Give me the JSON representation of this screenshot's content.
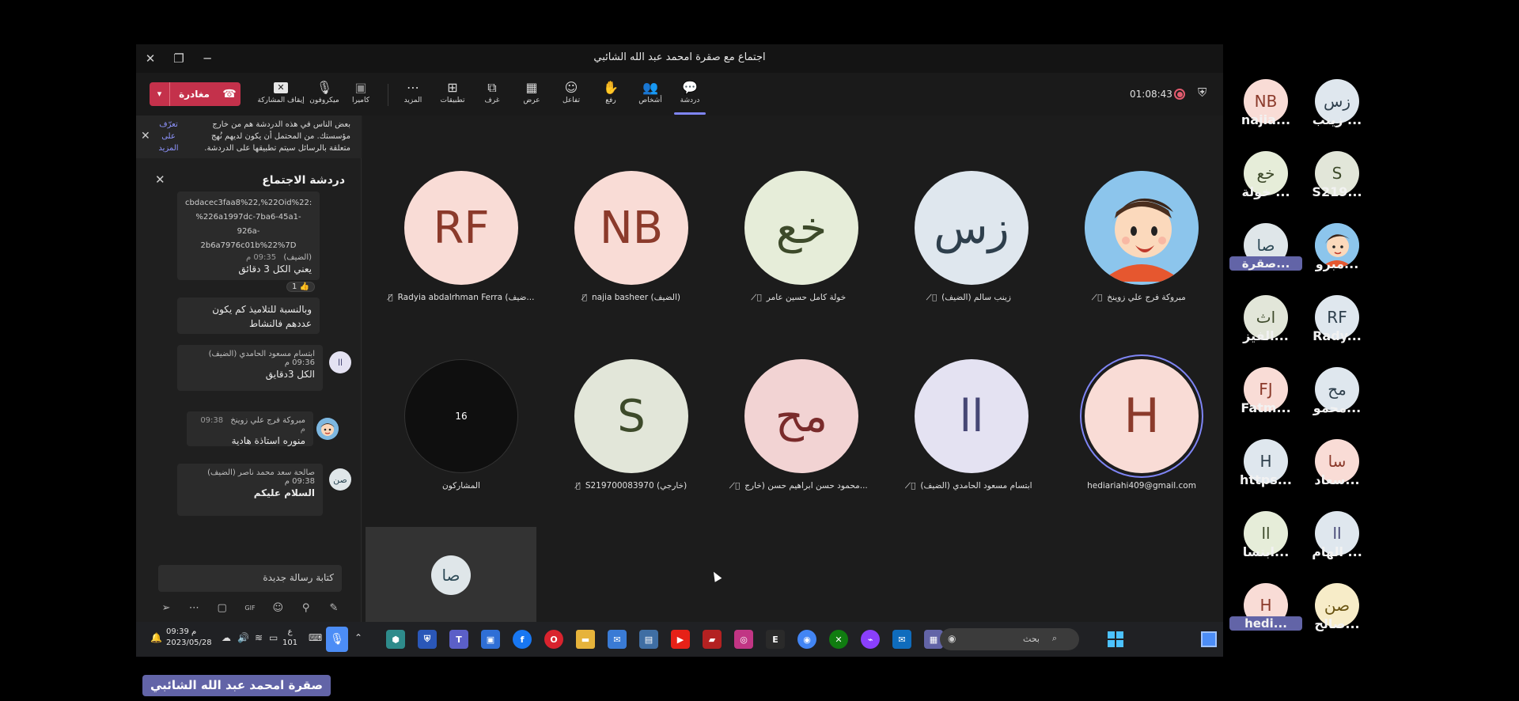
{
  "window": {
    "title": "اجتماع مع صقرة امحمد عبد الله الشائبي"
  },
  "toolbar": {
    "leave_label": "مغادرة",
    "timer": "01:08:43",
    "items": [
      {
        "label": "كاميرا",
        "icon": "camera-off-icon"
      },
      {
        "label": "ميكروفون",
        "icon": "microphone-icon"
      },
      {
        "label": "إيقاف المشاركة",
        "icon": "stop-share-icon"
      },
      {
        "label": "المزيد",
        "icon": "more-icon"
      },
      {
        "label": "تطبيقات",
        "icon": "apps-icon"
      },
      {
        "label": "غرف",
        "icon": "rooms-icon"
      },
      {
        "label": "عرض",
        "icon": "view-icon"
      },
      {
        "label": "تفاعل",
        "icon": "react-icon"
      },
      {
        "label": "رفع",
        "icon": "raise-hand-icon"
      },
      {
        "label": "أشخاص",
        "icon": "people-icon"
      },
      {
        "label": "دردشة",
        "icon": "chat-icon"
      }
    ]
  },
  "chat": {
    "notice_text": "بعض الناس في هذه الدردشة هم من خارج مؤسستك. من المحتمل أن يكون لديهم نُهج متعلقة بالرسائل سيتم تطبيقها على الدردشة.",
    "notice_link": "تعرّف على المزيد",
    "title": "دردشة الاجتماع",
    "compose_placeholder": "كتابة رسالة جديدة",
    "messages": [
      {
        "link_lines": [
          "cbdacec3faa8%22,%22Oid%22:",
          "%226a1997dc-7ba6-45a1-926a-",
          "2b6a7976c01b%22%7D"
        ],
        "meta": "(الضيف)",
        "time": "09:35 م",
        "body": "يعني الكل 3 دقائق",
        "reaction": "1 👍"
      },
      {
        "body": "وبالنسبة للتلاميذ كم يكون عددهم فالنشاط"
      },
      {
        "avatar": "اا",
        "meta": "ابتسام مسعود الحامدي (الضيف)",
        "time": "09:36 م",
        "body": "الكل 3دقايق"
      },
      {
        "meta": "مبروكة فرج علي زوينخ",
        "time": "09:38 م",
        "body": "منوره استاذة هادية"
      },
      {
        "avatar": "صن",
        "meta": "صالحة سعد محمد ناصر (الضيف)",
        "time": "09:38 م",
        "body": "السلام عليكم"
      }
    ]
  },
  "grid": {
    "tiles": [
      {
        "initials": "RF",
        "name": "Radyia abdalrhman Ferra (ضيف...",
        "bg": "#f9dcd6",
        "fg": "#8b3a2b",
        "muted": true
      },
      {
        "initials": "NB",
        "name": "najia basheer (الضيف)",
        "bg": "#f9dcd6",
        "fg": "#8b3a2b",
        "muted": true
      },
      {
        "initials": "خع",
        "name": "خولة كامل حسين عامر",
        "bg": "#e6edd9",
        "fg": "#3d4a2a",
        "muted": true
      },
      {
        "initials": "زس",
        "name": "زينب سالم (الضيف)",
        "bg": "#dfe7ee",
        "fg": "#2e3f4c",
        "muted": true
      },
      {
        "initials": "",
        "name": "مبروكة فرج علي زوينخ",
        "bg": "#6fb0e0",
        "fg": "#ffffff",
        "muted": true
      },
      {
        "initials": "16",
        "name": "المشاركون",
        "bg": "#0f0f0f",
        "fg": "#ffffff",
        "muted": false
      },
      {
        "initials": "S",
        "name": "S219700083970 (خارجي)",
        "bg": "#e2e6d9",
        "fg": "#3d4a2a",
        "muted": true
      },
      {
        "initials": "مح",
        "name": "محمود حسن ابراهيم حسن (خارج...",
        "bg": "#f2d3d3",
        "fg": "#7a2b2b",
        "muted": true
      },
      {
        "initials": "اا",
        "name": "ابتسام مسعود الحامدي (الضيف)",
        "bg": "#e4e2f2",
        "fg": "#464775",
        "muted": true
      },
      {
        "initials": "H",
        "name": "hediariahi409@gmail.com",
        "bg": "#f9dcd6",
        "fg": "#8b3a2b",
        "muted": false
      }
    ],
    "self_initials": "صا"
  },
  "taskbar": {
    "time": "09:39 م",
    "date": "2023/05/28",
    "lang": "ع",
    "lang_sub": "101",
    "search_placeholder": "بحث",
    "apps": [
      {
        "icon": "cube-icon",
        "color": "#2e8b8b"
      },
      {
        "icon": "shield-app-icon",
        "color": "#2a57b8"
      },
      {
        "icon": "teams-icon",
        "color": "#5b5fc7"
      },
      {
        "icon": "remote-desktop-icon",
        "color": "#2f6fd6"
      },
      {
        "icon": "facebook-icon",
        "color": "#1877f2"
      },
      {
        "icon": "opera-icon",
        "color": "#d9232e"
      },
      {
        "icon": "folder-icon",
        "color": "#e6b33b"
      },
      {
        "icon": "mail-app-icon",
        "color": "#3a7bd5"
      },
      {
        "icon": "photos-icon",
        "color": "#3f6ea3"
      },
      {
        "icon": "youtube-icon",
        "color": "#e62117"
      },
      {
        "icon": "media-icon",
        "color": "#b32121"
      },
      {
        "icon": "instagram-icon",
        "color": "#c13584"
      },
      {
        "icon": "epic-icon",
        "color": "#2a2a2a"
      },
      {
        "icon": "chrome-icon",
        "color": "#4285f4"
      },
      {
        "icon": "xbox-icon",
        "color": "#107c10"
      },
      {
        "icon": "messenger-icon",
        "color": "#8a3ffc"
      },
      {
        "icon": "outlook-icon",
        "color": "#0f6cbd"
      },
      {
        "icon": "chat-app-icon",
        "color": "#6264a7"
      }
    ]
  },
  "participants_strip": [
    {
      "initials": "زس",
      "name": "زينب ...",
      "bg": "#dfe7ee",
      "fg": "#2e3f4c",
      "highlight": false
    },
    {
      "initials": "NB",
      "name": "najia...",
      "bg": "#f9dcd6",
      "fg": "#8b3a2b",
      "highlight": false
    },
    {
      "initials": "S",
      "name": "S219...",
      "bg": "#e2e6d9",
      "fg": "#3d4a2a",
      "highlight": false
    },
    {
      "initials": "خع",
      "name": "خولة ...",
      "bg": "#e6edd9",
      "fg": "#3d4a2a",
      "highlight": false
    },
    {
      "initials": "",
      "name": "مبرو...",
      "bg": "#6fb0e0",
      "fg": "#ffffff",
      "highlight": false
    },
    {
      "initials": "صا",
      "name": "صقرة...",
      "bg": "#dfe6e9",
      "fg": "#2e4a57",
      "highlight": true
    },
    {
      "initials": "RF",
      "name": "Rady...",
      "bg": "#dfe7ee",
      "fg": "#2e3f4c",
      "highlight": false
    },
    {
      "initials": "اث",
      "name": "الفيز...",
      "bg": "#e2e6d9",
      "fg": "#3d4a2a",
      "highlight": false
    },
    {
      "initials": "مح",
      "name": "محمو...",
      "bg": "#dfe7ee",
      "fg": "#2e3f4c",
      "highlight": false
    },
    {
      "initials": "FJ",
      "name": "Fatm...",
      "bg": "#f9dcd6",
      "fg": "#8b3a2b",
      "highlight": false
    },
    {
      "initials": "سا",
      "name": "سعاد...",
      "bg": "#f9dcd6",
      "fg": "#8b3a2b",
      "highlight": false
    },
    {
      "initials": "H",
      "name": "https...",
      "bg": "#dfe7ee",
      "fg": "#2e3f4c",
      "highlight": false
    },
    {
      "initials": "اا",
      "name": "الهام ...",
      "bg": "#dfe7ee",
      "fg": "#464775",
      "highlight": false
    },
    {
      "initials": "اا",
      "name": "ابتسا...",
      "bg": "#e6edd9",
      "fg": "#3d4a2a",
      "highlight": false
    },
    {
      "initials": "صن",
      "name": "صالح...",
      "bg": "#f7ecc8",
      "fg": "#6a5412",
      "highlight": false
    },
    {
      "initials": "H",
      "name": "hedi...",
      "bg": "#f9dcd6",
      "fg": "#8b3a2b",
      "highlight": true
    }
  ],
  "name_label": "صقرة امحمد عبد الله الشائبي",
  "colors": {
    "accent": "#6264a7",
    "leave": "#c4314b",
    "record": "#e25b6e"
  }
}
